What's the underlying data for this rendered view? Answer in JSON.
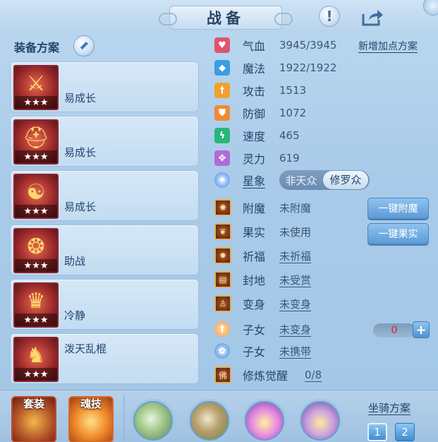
{
  "header": {
    "title": "战备"
  },
  "equip": {
    "section_title": "装备方案",
    "schemes": [
      {
        "label": "易成长",
        "stars": "★★★",
        "icon": "golden-staff-icon",
        "label_pos": "bottom"
      },
      {
        "label": "易成长",
        "stars": "★★★",
        "icon": "red-helmet-icon",
        "label_pos": "bottom"
      },
      {
        "label": "易成长",
        "stars": "★★★",
        "icon": "demon-mask-icon",
        "label_pos": "bottom"
      },
      {
        "label": "助战",
        "stars": "★★★",
        "icon": "bead-necklace-icon",
        "label_pos": "bottom"
      },
      {
        "label": "冷静",
        "stars": "★★★",
        "icon": "jeweled-crown-icon",
        "label_pos": "bottom"
      },
      {
        "label": "泼天乱棍",
        "stars": "★★★",
        "icon": "blue-warrior-icon",
        "label_pos": "top"
      }
    ]
  },
  "attributes": {
    "add_plan_label": "新增加点方案",
    "stats": [
      {
        "name": "气血",
        "value": "3945/3945",
        "icon": "heart-icon",
        "color": "#e0556e"
      },
      {
        "name": "魔法",
        "value": "1922/1922",
        "icon": "diamond-icon",
        "color": "#3d9de0"
      },
      {
        "name": "攻击",
        "value": "1513",
        "icon": "sword-icon",
        "color": "#f0a22e"
      },
      {
        "name": "防御",
        "value": "1072",
        "icon": "shield-icon",
        "color": "#ef8a3a"
      },
      {
        "name": "速度",
        "value": "465",
        "icon": "lightning-icon",
        "color": "#28b67a"
      },
      {
        "name": "灵力",
        "value": "619",
        "icon": "spirit-icon",
        "color": "#b06ad8"
      }
    ],
    "star_sign": {
      "name": "星象",
      "options": [
        "非天众",
        "修罗众"
      ],
      "selected": "修罗众"
    },
    "extras": [
      {
        "name": "附魔",
        "value": "未附魔",
        "icon": "enchant-icon",
        "underline": false
      },
      {
        "name": "果实",
        "value": "未使用",
        "icon": "fruit-icon",
        "underline": false
      },
      {
        "name": "祈福",
        "value": "未祈福",
        "icon": "blessing-icon",
        "underline": true
      },
      {
        "name": "封地",
        "value": "未受赏",
        "icon": "fief-icon",
        "underline": true
      },
      {
        "name": "变身",
        "value": "未变身",
        "icon": "transform-icon",
        "underline": true
      }
    ],
    "child_1": {
      "name": "子女",
      "value": "未变身",
      "counter": "0"
    },
    "child_2": {
      "name": "子女",
      "value": "未携带"
    },
    "cultivation": {
      "name": "修炼觉醒",
      "value": "0/8"
    },
    "buttons": {
      "enchant": "一键附魔",
      "fruit": "一键果实"
    }
  },
  "bottom": {
    "suit_label": "套装",
    "soul_skill_label": "魂技",
    "mount_title": "坐骑方案",
    "mount_buttons": [
      "1",
      "2"
    ]
  }
}
